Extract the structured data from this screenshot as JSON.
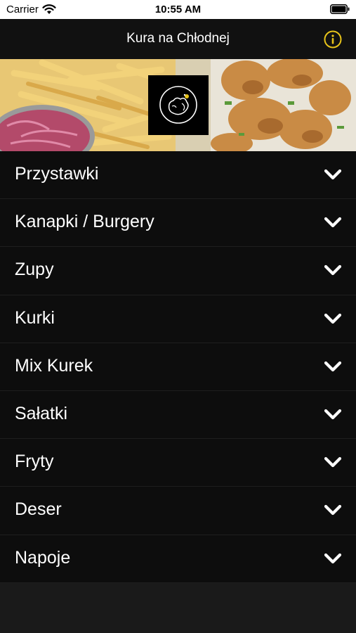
{
  "status_bar": {
    "carrier": "Carrier",
    "time": "10:55 AM"
  },
  "nav": {
    "title": "Kura na Chłodnej",
    "info_icon": "info-icon",
    "accent_color": "#e8c41a"
  },
  "hero": {
    "background": "food-photo",
    "logo_icon": "rooster-logo-icon"
  },
  "menu": {
    "items": [
      {
        "label": "Przystawki"
      },
      {
        "label": "Kanapki / Burgery"
      },
      {
        "label": "Zupy"
      },
      {
        "label": "Kurki"
      },
      {
        "label": "Mix Kurek"
      },
      {
        "label": "Sałatki"
      },
      {
        "label": "Fryty"
      },
      {
        "label": "Deser"
      },
      {
        "label": "Napoje"
      }
    ],
    "chevron_icon": "chevron-down-icon"
  }
}
